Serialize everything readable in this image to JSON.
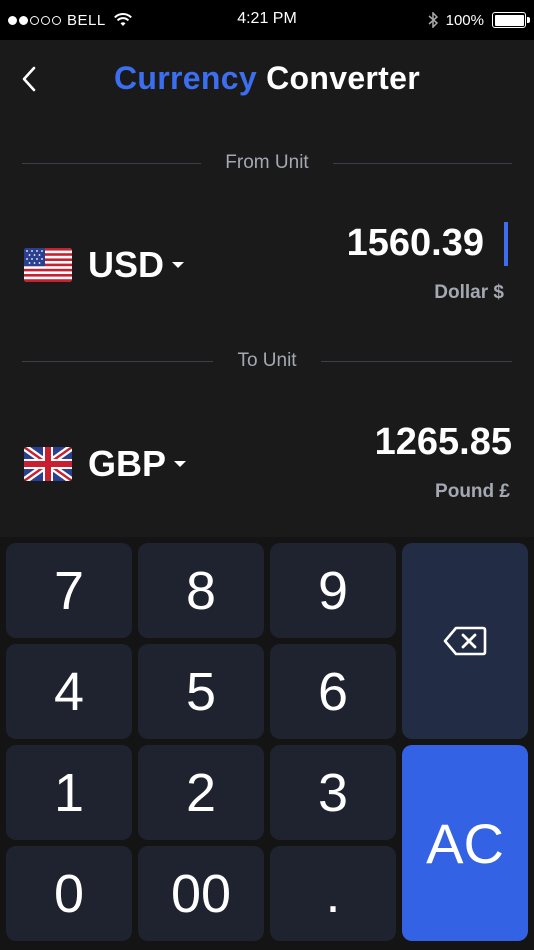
{
  "status_bar": {
    "carrier": "BELL",
    "time": "4:21 PM",
    "battery": "100%",
    "battery_level": 1.0,
    "signal_bars_filled": 2,
    "signal_bars_total": 5
  },
  "header": {
    "title_accent": "Currency",
    "title_rest": "Converter",
    "accent_color": "#3b6ff0"
  },
  "from": {
    "section_label": "From Unit",
    "currency_code": "USD",
    "amount": "1560.39",
    "unit_name": "Dollar $",
    "flag_icon": "us-flag-icon"
  },
  "to": {
    "section_label": "To Unit",
    "currency_code": "GBP",
    "amount": "1265.85",
    "unit_name": "Pound £",
    "flag_icon": "uk-flag-icon"
  },
  "keypad": {
    "digits": [
      "7",
      "8",
      "9",
      "4",
      "5",
      "6",
      "1",
      "2",
      "3",
      "0",
      "00",
      "."
    ],
    "clear_label": "AC",
    "delete_icon": "backspace-icon"
  }
}
